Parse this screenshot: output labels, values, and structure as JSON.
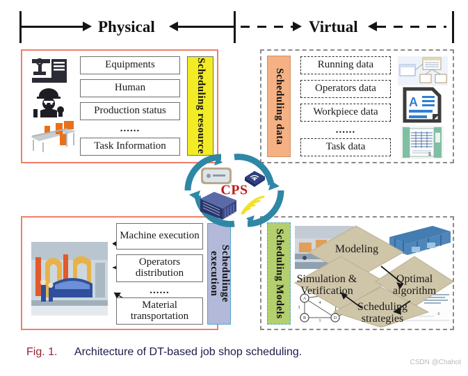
{
  "header": {
    "left_label": "Physical",
    "right_label": "Virtual",
    "left_arrow_out": "arrow-right",
    "left_arrow_in": "arrow-left",
    "right_arrow_out": "arrow-right",
    "right_arrow_in": "arrow-left"
  },
  "hub": {
    "label": "CPS",
    "label_color": "#c01a1a",
    "ring_color": "#2f87a6",
    "icons": [
      "sensor-device-icon",
      "wireless-router-icon",
      "server-rack-icon",
      "signal-waves-icon"
    ]
  },
  "quadrants": {
    "top_left": {
      "name": "Scheduling resource",
      "bar_label": "Scheduling resource",
      "bar_color": "#f2ec26",
      "border_color": "#ef7f6a",
      "border_style": "solid",
      "items": [
        "Equipments",
        "Human",
        "Production status",
        "Task Information"
      ],
      "ellipsis": "......",
      "icons": [
        "cnc-machine-icon",
        "worker-helmet-icon",
        "conveyor-line-icon"
      ]
    },
    "top_right": {
      "name": "Scheduling data",
      "bar_label": "Scheduling data",
      "bar_color": "#f5b183",
      "border_color": "#8a8a8a",
      "border_style": "dashed",
      "items": [
        "Running data",
        "Operators data",
        "Workpiece data",
        "Task data"
      ],
      "ellipsis": "......",
      "icons": [
        "database-diagram-icon",
        "document-text-icon",
        "spreadsheet-book-icon"
      ]
    },
    "bottom_left": {
      "name": "Schedulinge execution",
      "bar_label": "Schedulinge execution",
      "bar_color": "#b3b9d8",
      "border_color": "#ef7f6a",
      "border_style": "solid",
      "items": [
        "Machine execution",
        "Operators distribution",
        "Material transportation"
      ],
      "ellipsis": "......",
      "icons": [
        "assembly-line-photo"
      ]
    },
    "bottom_right": {
      "name": "Scheduling Models",
      "bar_label": "Scheduling Models",
      "bar_color": "#b3cf6e",
      "border_color": "#8a8a8a",
      "border_style": "dashed",
      "nodes": [
        "Modeling",
        "Optimal algorithm",
        "Scheduling strategies",
        "Simulation & Verification"
      ],
      "node_color": "#cfc5a8",
      "icons": [
        "factory-photo",
        "3d-line-model-icon",
        "graph-network-icon",
        "gantt-chart-icon"
      ]
    }
  },
  "caption": {
    "figure_number": "Fig. 1.",
    "text": "Architecture of DT-based job shop scheduling.",
    "number_color": "#9c1f2e",
    "text_color": "#1b1b4b"
  },
  "watermark": "CSDN @Chahot"
}
